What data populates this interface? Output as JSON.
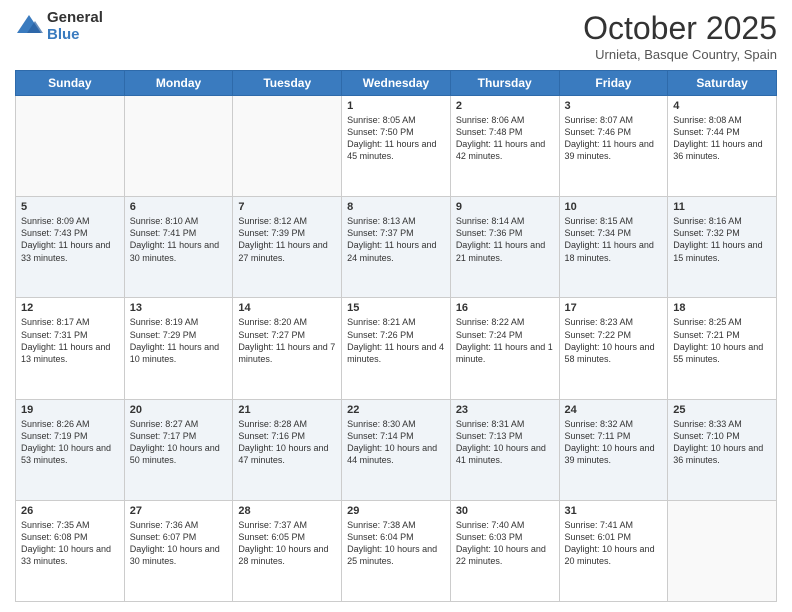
{
  "logo": {
    "general": "General",
    "blue": "Blue"
  },
  "title": "October 2025",
  "subtitle": "Urnieta, Basque Country, Spain",
  "days": [
    "Sunday",
    "Monday",
    "Tuesday",
    "Wednesday",
    "Thursday",
    "Friday",
    "Saturday"
  ],
  "weeks": [
    [
      {
        "day": "",
        "text": ""
      },
      {
        "day": "",
        "text": ""
      },
      {
        "day": "",
        "text": ""
      },
      {
        "day": "1",
        "text": "Sunrise: 8:05 AM\nSunset: 7:50 PM\nDaylight: 11 hours and 45 minutes."
      },
      {
        "day": "2",
        "text": "Sunrise: 8:06 AM\nSunset: 7:48 PM\nDaylight: 11 hours and 42 minutes."
      },
      {
        "day": "3",
        "text": "Sunrise: 8:07 AM\nSunset: 7:46 PM\nDaylight: 11 hours and 39 minutes."
      },
      {
        "day": "4",
        "text": "Sunrise: 8:08 AM\nSunset: 7:44 PM\nDaylight: 11 hours and 36 minutes."
      }
    ],
    [
      {
        "day": "5",
        "text": "Sunrise: 8:09 AM\nSunset: 7:43 PM\nDaylight: 11 hours and 33 minutes."
      },
      {
        "day": "6",
        "text": "Sunrise: 8:10 AM\nSunset: 7:41 PM\nDaylight: 11 hours and 30 minutes."
      },
      {
        "day": "7",
        "text": "Sunrise: 8:12 AM\nSunset: 7:39 PM\nDaylight: 11 hours and 27 minutes."
      },
      {
        "day": "8",
        "text": "Sunrise: 8:13 AM\nSunset: 7:37 PM\nDaylight: 11 hours and 24 minutes."
      },
      {
        "day": "9",
        "text": "Sunrise: 8:14 AM\nSunset: 7:36 PM\nDaylight: 11 hours and 21 minutes."
      },
      {
        "day": "10",
        "text": "Sunrise: 8:15 AM\nSunset: 7:34 PM\nDaylight: 11 hours and 18 minutes."
      },
      {
        "day": "11",
        "text": "Sunrise: 8:16 AM\nSunset: 7:32 PM\nDaylight: 11 hours and 15 minutes."
      }
    ],
    [
      {
        "day": "12",
        "text": "Sunrise: 8:17 AM\nSunset: 7:31 PM\nDaylight: 11 hours and 13 minutes."
      },
      {
        "day": "13",
        "text": "Sunrise: 8:19 AM\nSunset: 7:29 PM\nDaylight: 11 hours and 10 minutes."
      },
      {
        "day": "14",
        "text": "Sunrise: 8:20 AM\nSunset: 7:27 PM\nDaylight: 11 hours and 7 minutes."
      },
      {
        "day": "15",
        "text": "Sunrise: 8:21 AM\nSunset: 7:26 PM\nDaylight: 11 hours and 4 minutes."
      },
      {
        "day": "16",
        "text": "Sunrise: 8:22 AM\nSunset: 7:24 PM\nDaylight: 11 hours and 1 minute."
      },
      {
        "day": "17",
        "text": "Sunrise: 8:23 AM\nSunset: 7:22 PM\nDaylight: 10 hours and 58 minutes."
      },
      {
        "day": "18",
        "text": "Sunrise: 8:25 AM\nSunset: 7:21 PM\nDaylight: 10 hours and 55 minutes."
      }
    ],
    [
      {
        "day": "19",
        "text": "Sunrise: 8:26 AM\nSunset: 7:19 PM\nDaylight: 10 hours and 53 minutes."
      },
      {
        "day": "20",
        "text": "Sunrise: 8:27 AM\nSunset: 7:17 PM\nDaylight: 10 hours and 50 minutes."
      },
      {
        "day": "21",
        "text": "Sunrise: 8:28 AM\nSunset: 7:16 PM\nDaylight: 10 hours and 47 minutes."
      },
      {
        "day": "22",
        "text": "Sunrise: 8:30 AM\nSunset: 7:14 PM\nDaylight: 10 hours and 44 minutes."
      },
      {
        "day": "23",
        "text": "Sunrise: 8:31 AM\nSunset: 7:13 PM\nDaylight: 10 hours and 41 minutes."
      },
      {
        "day": "24",
        "text": "Sunrise: 8:32 AM\nSunset: 7:11 PM\nDaylight: 10 hours and 39 minutes."
      },
      {
        "day": "25",
        "text": "Sunrise: 8:33 AM\nSunset: 7:10 PM\nDaylight: 10 hours and 36 minutes."
      }
    ],
    [
      {
        "day": "26",
        "text": "Sunrise: 7:35 AM\nSunset: 6:08 PM\nDaylight: 10 hours and 33 minutes."
      },
      {
        "day": "27",
        "text": "Sunrise: 7:36 AM\nSunset: 6:07 PM\nDaylight: 10 hours and 30 minutes."
      },
      {
        "day": "28",
        "text": "Sunrise: 7:37 AM\nSunset: 6:05 PM\nDaylight: 10 hours and 28 minutes."
      },
      {
        "day": "29",
        "text": "Sunrise: 7:38 AM\nSunset: 6:04 PM\nDaylight: 10 hours and 25 minutes."
      },
      {
        "day": "30",
        "text": "Sunrise: 7:40 AM\nSunset: 6:03 PM\nDaylight: 10 hours and 22 minutes."
      },
      {
        "day": "31",
        "text": "Sunrise: 7:41 AM\nSunset: 6:01 PM\nDaylight: 10 hours and 20 minutes."
      },
      {
        "day": "",
        "text": ""
      }
    ]
  ]
}
